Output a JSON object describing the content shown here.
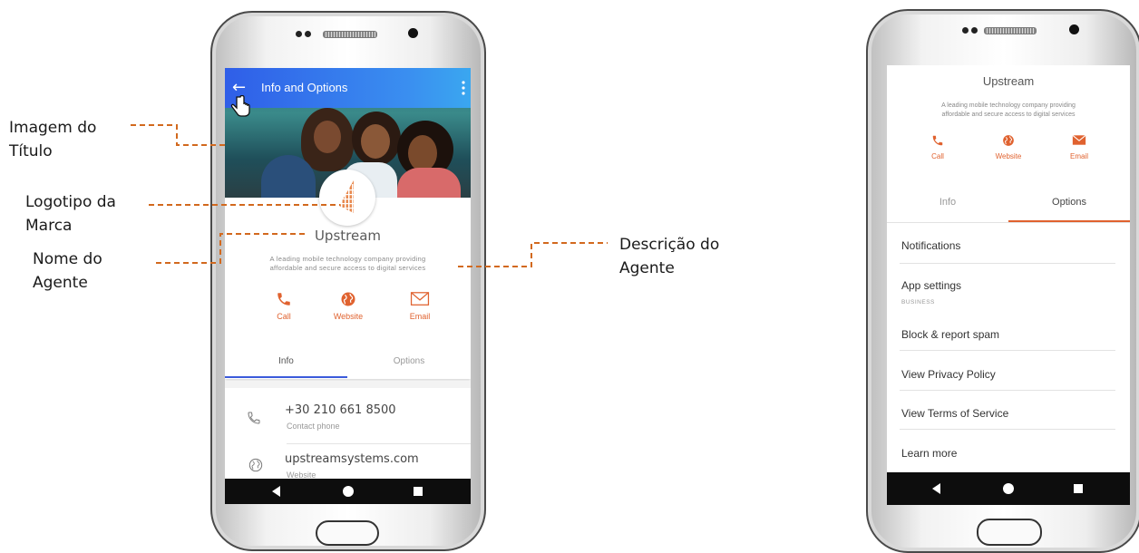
{
  "annotations": {
    "title_image": [
      "Imagem do",
      "Título"
    ],
    "brand_logo": [
      "Logotipo da",
      "Marca"
    ],
    "agent_name": [
      "Nome do",
      "Agente"
    ],
    "agent_description": [
      "Descrição do",
      "Agente"
    ]
  },
  "left_phone": {
    "header_title": "Info and Options",
    "agent_name": "Upstream",
    "description_line1": "A leading mobile technology company providing",
    "description_line2": "affordable and secure access to digital services",
    "actions": [
      {
        "label": "Call",
        "icon": "phone-icon"
      },
      {
        "label": "Website",
        "icon": "globe-icon"
      },
      {
        "label": "Email",
        "icon": "envelope-icon"
      }
    ],
    "tabs": [
      {
        "label": "Info",
        "active": true
      },
      {
        "label": "Options",
        "active": false
      }
    ],
    "info_rows": [
      {
        "value": "+30 210 661 8500",
        "caption": "Contact phone",
        "icon": "phone-icon"
      },
      {
        "value": "upstreamsystems.com",
        "caption": "Website",
        "icon": "globe-icon"
      }
    ]
  },
  "right_phone": {
    "agent_name": "Upstream",
    "description_line1": "A leading mobile technology company providing",
    "description_line2": "affordable and secure access to digital services",
    "actions": [
      {
        "label": "Call",
        "icon": "phone-icon"
      },
      {
        "label": "Website",
        "icon": "globe-icon"
      },
      {
        "label": "Email",
        "icon": "envelope-icon"
      }
    ],
    "tabs": [
      {
        "label": "Info",
        "active": false
      },
      {
        "label": "Options",
        "active": true
      }
    ],
    "options": {
      "notifications": "Notifications",
      "app_settings": "App settings",
      "business_section": "BUSINESS",
      "block_spam": "Block & report spam",
      "privacy": "View Privacy Policy",
      "terms": "View Terms of Service",
      "learn_more": "Learn more"
    }
  },
  "colors": {
    "header_blue": "#2f5ee8",
    "accent_orange": "#e0622f",
    "tab_underline_blue": "#3b5bdb"
  }
}
